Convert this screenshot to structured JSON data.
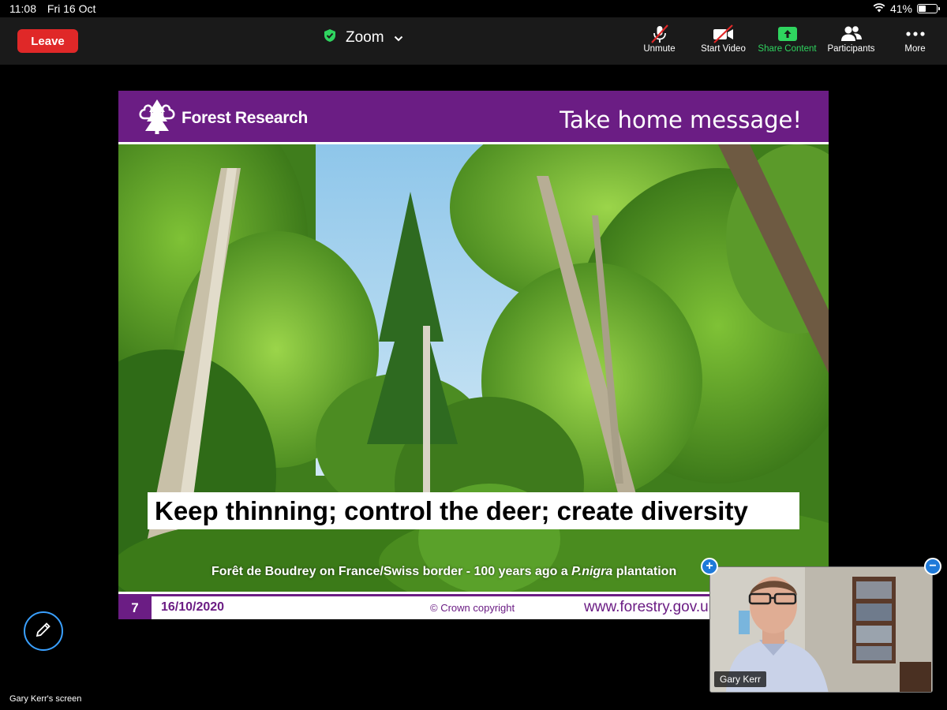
{
  "status_bar": {
    "time": "11:08",
    "date": "Fri 16 Oct",
    "battery": "41%",
    "battery_level": 0.41
  },
  "toolbar": {
    "leave_label": "Leave",
    "meeting_title": "Zoom",
    "tools": [
      {
        "label": "Unmute",
        "icon": "muted-mic-icon"
      },
      {
        "label": "Start Video",
        "icon": "video-off-icon"
      },
      {
        "label": "Share Content",
        "icon": "share-screen-icon"
      },
      {
        "label": "Participants",
        "icon": "participants-icon"
      },
      {
        "label": "More",
        "icon": "more-dots-icon"
      }
    ],
    "accent_color": "#2fd45f",
    "leave_color": "#e02828"
  },
  "slide": {
    "logo_text": "Forest Research",
    "title": "Take home message!",
    "message": "Keep thinning; control the deer; create diversity",
    "caption_before": "Forêt de Boudrey on France/Swiss border - 100 years ago a ",
    "caption_italic": "P.nigra",
    "caption_after": " plantation",
    "page_number": "7",
    "date": "16/10/2020",
    "copyright": "© Crown copyright",
    "url": "www.forestry.gov.uk",
    "brand_color": "#6b1d84"
  },
  "video": {
    "participant_name": "Gary Kerr"
  },
  "screen_label": "Gary Kerr's screen"
}
